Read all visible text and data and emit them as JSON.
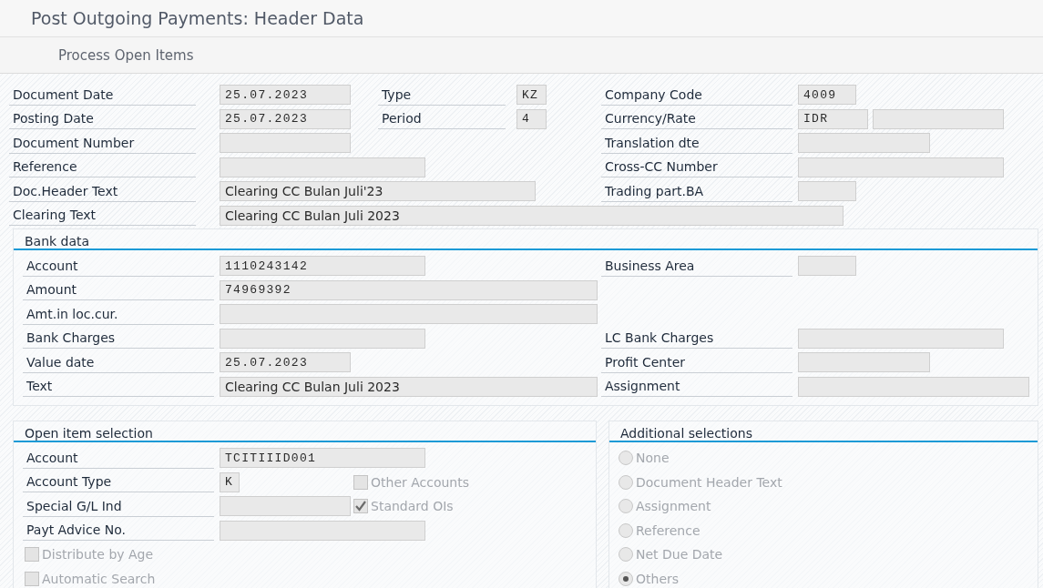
{
  "window": {
    "title": "Post Outgoing Payments: Header Data"
  },
  "toolbar": {
    "buttons": [
      "Process Open Items"
    ]
  },
  "header": {
    "rows": [
      {
        "left": {
          "label": "Document Date",
          "value": "25.07.2023"
        },
        "middle": {
          "label": "Type",
          "value": "KZ"
        },
        "right": {
          "label": "Company Code",
          "value": "4009"
        }
      },
      {
        "left": {
          "label": "Posting Date",
          "value": "25.07.2023"
        },
        "middle": {
          "label": "Period",
          "value": "4"
        },
        "right": {
          "label": "Currency/Rate",
          "value": "IDR"
        }
      },
      {
        "left": {
          "label": "Document Number"
        },
        "right": {
          "label": "Translation dte"
        }
      },
      {
        "left": {
          "label": "Reference"
        },
        "right": {
          "label": "Cross-CC Number"
        }
      },
      {
        "left": {
          "label": "Doc.Header Text",
          "value": "Clearing CC Bulan Juli'23"
        },
        "right": {
          "label": "Trading part.BA"
        }
      },
      {
        "left": {
          "label": "Clearing Text",
          "value": "Clearing CC Bulan Juli 2023"
        }
      }
    ]
  },
  "bank_data": {
    "title": "Bank data",
    "rows": [
      {
        "left": {
          "label": "Account",
          "value": "1110243142"
        },
        "right": {
          "label": "Business Area"
        }
      },
      {
        "left": {
          "label": "Amount",
          "value": "74969392"
        }
      },
      {
        "left": {
          "label": "Amt.in loc.cur."
        }
      },
      {
        "left": {
          "label": "Bank Charges"
        },
        "right": {
          "label": "LC Bank Charges"
        }
      },
      {
        "left": {
          "label": "Value date",
          "value": "25.07.2023"
        },
        "right": {
          "label": "Profit Center"
        }
      },
      {
        "left": {
          "label": "Text",
          "value": "Clearing CC Bulan Juli 2023"
        },
        "right": {
          "label": "Assignment"
        }
      }
    ]
  },
  "open_item_selection": {
    "title": "Open item selection",
    "rows": [
      {
        "label": "Account",
        "value": "TCITIIID001"
      },
      {
        "label": "Account Type",
        "value": "K",
        "option": {
          "label": "Other Accounts",
          "checked": false,
          "disabled": true
        }
      },
      {
        "label": "Special G/L Ind",
        "option": {
          "label": "Standard OIs",
          "checked": true,
          "disabled": true
        }
      },
      {
        "label": "Payt Advice No."
      }
    ],
    "options": [
      {
        "label": "Distribute by Age",
        "checked": false,
        "disabled": true
      },
      {
        "label": "Automatic Search",
        "checked": false,
        "disabled": true
      }
    ]
  },
  "additional_selections": {
    "title": "Additional selections",
    "options": [
      {
        "label": "None",
        "selected": false,
        "disabled": true
      },
      {
        "label": "Document Header Text",
        "selected": false,
        "disabled": true
      },
      {
        "label": "Assignment",
        "selected": false,
        "disabled": true
      },
      {
        "label": "Reference",
        "selected": false,
        "disabled": true
      },
      {
        "label": "Net Due Date",
        "selected": false,
        "disabled": true
      },
      {
        "label": "Others",
        "selected": true,
        "disabled": true
      }
    ]
  }
}
